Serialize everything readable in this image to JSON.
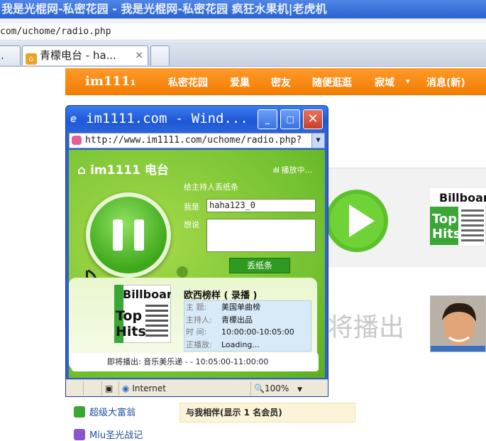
{
  "browser": {
    "title": "我是光棍网-私密花园 - 我是光棍网-私密花园 疯狂水果机|老虎机",
    "address": "com/uchome/radio.php",
    "tabs": [
      {
        "label": "."
      },
      {
        "label": "青檬电台 - ha...",
        "close": "×"
      },
      {
        "label": ""
      }
    ]
  },
  "site": {
    "logo": "im111₁",
    "nav": [
      "私密花园",
      "爱巢",
      "密友",
      "随便逛逛",
      "寂域",
      "▾",
      "消息(新)"
    ]
  },
  "background": {
    "playing_soon_text": "将播出",
    "links": [
      {
        "label": "超级大富翁",
        "icon": "game-icon"
      },
      {
        "label": "Miu圣光战记",
        "icon": "game-icon"
      }
    ],
    "friends_box": "与我相伴(显示 1 名会员)"
  },
  "popup": {
    "title": "im1111.com - Wind...",
    "url": "http://www.im1111.com/uchome/radio.php?",
    "radio": {
      "logo": "im1111 电台",
      "status": "播放中...",
      "form_title": "给主持人丢纸条",
      "name_label": "我是",
      "name_value": "haha123_0",
      "msg_label": "想说",
      "throw_button": "丢纸条",
      "program_title": "欧西榜样 ( 录播 )",
      "details": [
        {
          "label": "主  题:",
          "value": "美国单曲榜"
        },
        {
          "label": "主持人:",
          "value": "青檬出品"
        },
        {
          "label": "时  间:",
          "value": "10:00:00-10:05:00"
        },
        {
          "label": "正播放:",
          "value": "Loading..."
        }
      ],
      "upcoming": "即将播出: 音乐美乐递 - - 10:05:00-11:00:00",
      "billboard_top": "Billboard",
      "billboard_bottom_1": "Top",
      "billboard_bottom_2": "Hits"
    },
    "status": {
      "zone": "Internet",
      "zoom": "100%"
    }
  }
}
